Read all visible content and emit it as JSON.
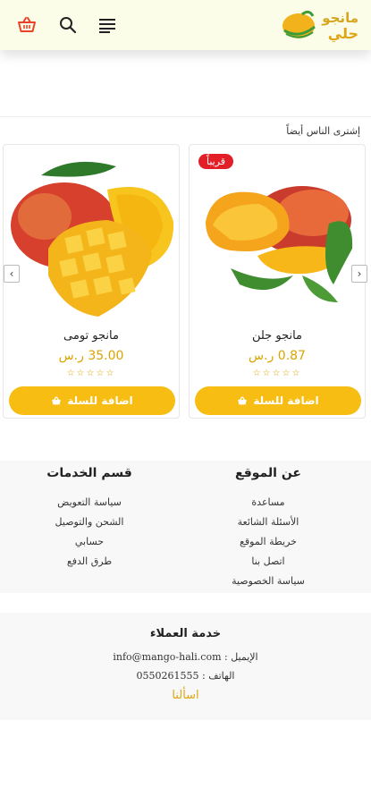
{
  "header": {
    "logo_line1": "مانجو",
    "logo_line2": "حلي",
    "icons": [
      "cart-icon",
      "search-icon",
      "menu-icon"
    ]
  },
  "section": {
    "title": "إشترى الناس أيضاً"
  },
  "products": [
    {
      "name": "مانجو جلن",
      "price": "0.87 ر.س",
      "stars": "☆☆☆☆☆",
      "badge": "قريباً",
      "button": "اضافة للسلة"
    },
    {
      "name": "مانجو تومى",
      "price": "35.00 ر.س",
      "stars": "☆☆☆☆☆",
      "badge": "",
      "button": "اضافة للسلة"
    }
  ],
  "footer": {
    "about": {
      "title": "عن الموقع",
      "links": [
        "مساعدة",
        "الأسئلة الشائعة",
        "خريطة الموقع",
        "اتصل بنا",
        "سياسة الخصوصية"
      ]
    },
    "services": {
      "title": "قسم الخدمات",
      "links": [
        "سياسة التعويض",
        "الشحن والتوصيل",
        "حسابي",
        "طرق الدفع"
      ]
    },
    "customer_service": {
      "title": "خدمة العملاء",
      "email": "الإيميل : info@mango-hali.com",
      "phone": "الهاتف : 0550261555",
      "ask": "اسألنا"
    }
  },
  "colors": {
    "accent": "#f7bd12",
    "badge": "#e21f26",
    "header_bg": "#fbfde9"
  }
}
